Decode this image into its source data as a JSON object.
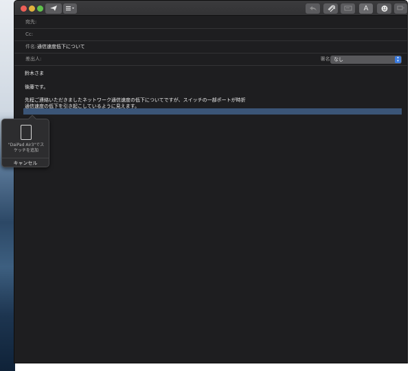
{
  "header": {
    "to_label": "宛先:",
    "cc_label": "Cc:",
    "subject_label": "件名:",
    "subject_value": "通信速度低下について",
    "from_label": "差出人:",
    "signature_label": "署名:",
    "signature_value": "なし"
  },
  "toolbar": {
    "format_label": "A",
    "icons": [
      "send-icon",
      "header-fields-icon",
      "reply-icon",
      "attachment-icon",
      "format-bar-icon",
      "font-icon",
      "emoji-icon",
      "photo-browser-icon"
    ]
  },
  "message": {
    "line1": "鈴木さま",
    "line2": "後藤です。",
    "line3": "先程ご連絡いただきましたネットワーク通信速度の低下についてですが、スイッチの一部ポートが時折",
    "line4": "通信速度の低下を引き起こしているように見えます。"
  },
  "sketch_popover": {
    "text": "\"DaiPad Air3\"でス\nケッチを追加",
    "cancel_label": "キャンセル"
  },
  "colors": {
    "window_background": "#1e1e20",
    "selection_highlight": "#3b5577",
    "accent_blue": "#3a7be0"
  }
}
